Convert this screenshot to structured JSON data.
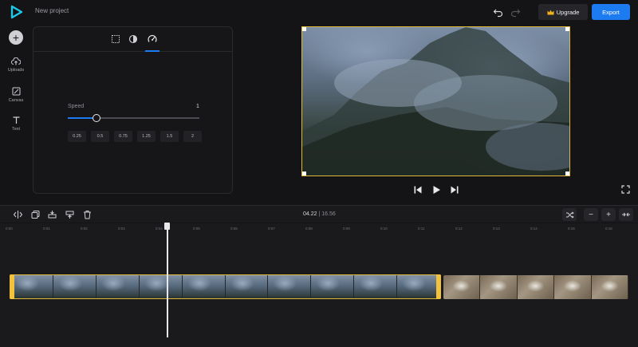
{
  "header": {
    "project_title": "New project",
    "upgrade_label": "Upgrade",
    "export_label": "Export",
    "accent": "#1d7bf2",
    "gold": "#e0b83a"
  },
  "sidebar": {
    "items": [
      {
        "label": "Uploads",
        "icon": "upload-cloud-icon"
      },
      {
        "label": "Canvas",
        "icon": "canvas-icon"
      },
      {
        "label": "Text",
        "icon": "text-icon"
      }
    ]
  },
  "panel": {
    "tabs": [
      {
        "icon": "crop-icon"
      },
      {
        "icon": "adjust-icon"
      },
      {
        "icon": "speed-gauge-icon",
        "active": true
      }
    ],
    "speed": {
      "label": "Speed",
      "value": "1",
      "fraction": 0.216,
      "presets": [
        "0.25",
        "0.5",
        "0.75",
        "1.25",
        "1.5",
        "2"
      ]
    }
  },
  "timeline": {
    "current_time": "04.22",
    "separator": "|",
    "total_time": "16.56",
    "ruler_ticks": [
      "0:00",
      "0:01",
      "0:02",
      "0:03",
      "0:04",
      "0:05",
      "0:06",
      "0:07",
      "0:08",
      "0:09",
      "0:10",
      "0:11",
      "0:12",
      "0:13",
      "0:14",
      "0:15",
      "0:16"
    ],
    "zoom_out_label": "−",
    "zoom_in_label": "+"
  }
}
